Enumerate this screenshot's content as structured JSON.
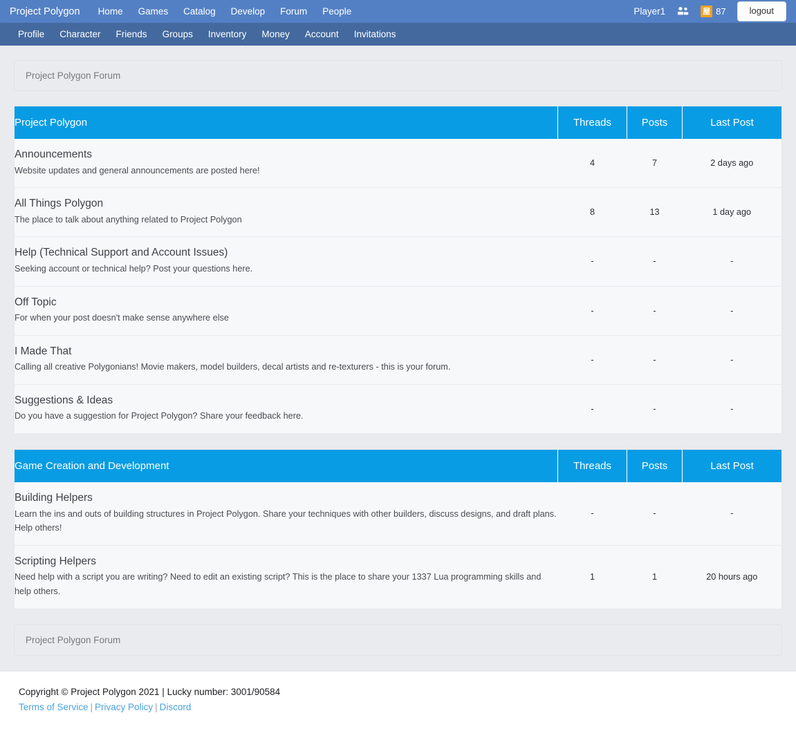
{
  "navbar": {
    "brand": "Project Polygon",
    "links": [
      {
        "label": "Home"
      },
      {
        "label": "Games"
      },
      {
        "label": "Catalog"
      },
      {
        "label": "Develop"
      },
      {
        "label": "Forum"
      },
      {
        "label": "People"
      }
    ],
    "username": "Player1",
    "friends_icon": "people-icon",
    "currency_icon": "polygon-currency-icon",
    "currency_glyph": "屋",
    "currency_amount": "87",
    "logout_label": "logout",
    "bg_color": "#5380c4"
  },
  "subnav": {
    "links": [
      {
        "label": "Profile"
      },
      {
        "label": "Character"
      },
      {
        "label": "Friends"
      },
      {
        "label": "Groups"
      },
      {
        "label": "Inventory"
      },
      {
        "label": "Money"
      },
      {
        "label": "Account"
      },
      {
        "label": "Invitations"
      }
    ],
    "bg_color": "#43699f"
  },
  "breadcrumb_top": "Project Polygon Forum",
  "breadcrumb_bottom": "Project Polygon Forum",
  "columns": {
    "threads": "Threads",
    "posts": "Posts",
    "last_post": "Last Post"
  },
  "accent_color": "#089ce4",
  "categories": [
    {
      "title": "Project Polygon",
      "forums": [
        {
          "name": "Announcements",
          "description": "Website updates and general announcements are posted here!",
          "threads": "4",
          "posts": "7",
          "last_post": "2 days ago"
        },
        {
          "name": "All Things Polygon",
          "description": "The place to talk about anything related to Project Polygon",
          "threads": "8",
          "posts": "13",
          "last_post": "1 day ago"
        },
        {
          "name": "Help (Technical Support and Account Issues)",
          "description": "Seeking account or technical help? Post your questions here.",
          "threads": "-",
          "posts": "-",
          "last_post": "-"
        },
        {
          "name": "Off Topic",
          "description": "For when your post doesn't make sense anywhere else",
          "threads": "-",
          "posts": "-",
          "last_post": "-"
        },
        {
          "name": "I Made That",
          "description": "Calling all creative Polygonians! Movie makers, model builders, decal artists and re-texturers - this is your forum.",
          "threads": "-",
          "posts": "-",
          "last_post": "-"
        },
        {
          "name": "Suggestions & Ideas",
          "description": "Do you have a suggestion for Project Polygon? Share your feedback here.",
          "threads": "-",
          "posts": "-",
          "last_post": "-"
        }
      ]
    },
    {
      "title": "Game Creation and Development",
      "forums": [
        {
          "name": "Building Helpers",
          "description": "Learn the ins and outs of building structures in Project Polygon. Share your techniques with other builders, discuss designs, and draft plans. Help others!",
          "threads": "-",
          "posts": "-",
          "last_post": "-"
        },
        {
          "name": "Scripting Helpers",
          "description": "Need help with a script you are writing? Need to edit an existing script? This is the place to share your 1337 Lua programming skills and help others.",
          "threads": "1",
          "posts": "1",
          "last_post": "20 hours ago"
        }
      ]
    }
  ],
  "footer": {
    "copyright": "Copyright © Project Polygon 2021 | Lucky number: 3001/90584",
    "links": [
      {
        "label": "Terms of Service"
      },
      {
        "label": "Privacy Policy"
      },
      {
        "label": "Discord"
      }
    ],
    "separator": "|"
  }
}
